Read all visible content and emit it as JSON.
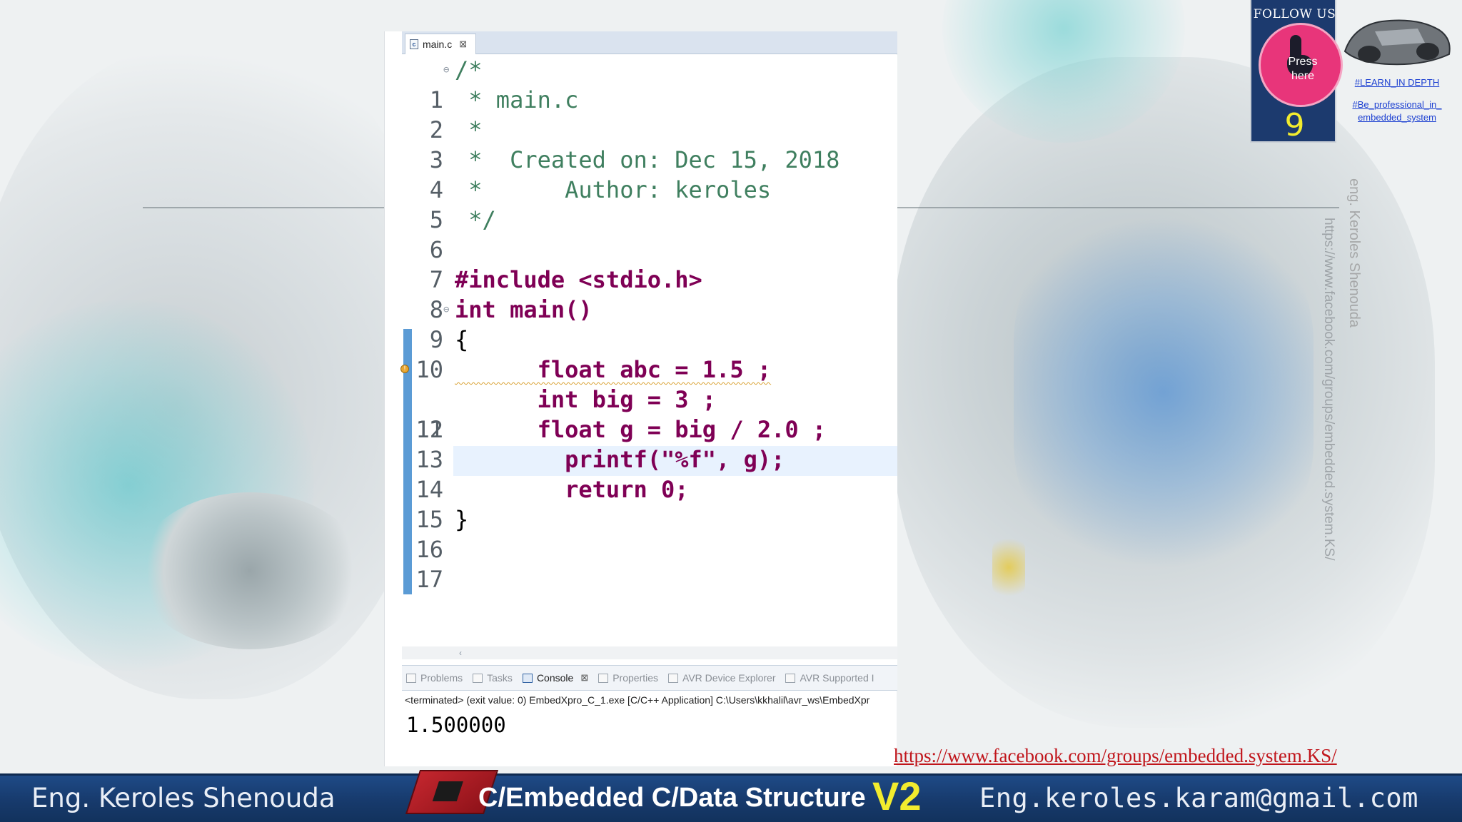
{
  "editor": {
    "tab_label": "main.c",
    "lines": [
      {
        "n": "1",
        "code": "/*"
      },
      {
        "n": "2",
        "code": " * main.c"
      },
      {
        "n": "3",
        "code": " *"
      },
      {
        "n": "4",
        "code": " *  Created on: Dec 15, 2018"
      },
      {
        "n": "5",
        "code": " *      Author: keroles"
      },
      {
        "n": "6",
        "code": " */"
      },
      {
        "n": "7",
        "code": ""
      },
      {
        "n": "8",
        "code": "#include <stdio.h>"
      },
      {
        "n": "9",
        "code": "int main()"
      },
      {
        "n": "10",
        "code": "{"
      },
      {
        "n": "11",
        "code": "      float abc = 1.5 ;"
      },
      {
        "n": "12",
        "code": "      int big = 3 ;"
      },
      {
        "n": "13",
        "code": "      float g = big / 2.0 ;"
      },
      {
        "n": "14",
        "code": "        printf(\"%f\", g);"
      },
      {
        "n": "15",
        "code": "        return 0;"
      },
      {
        "n": "16",
        "code": "}"
      },
      {
        "n": "17",
        "code": ""
      }
    ]
  },
  "console": {
    "tabs": [
      "Problems",
      "Tasks",
      "Console",
      "Properties",
      "AVR Device Explorer",
      "AVR Supported I"
    ],
    "active_tab": "Console",
    "status": "<terminated> (exit value: 0) EmbedXpro_C_1.exe [C/C++ Application] C:\\Users\\kkhalil\\avr_ws\\EmbedXpr",
    "output": "1.500000"
  },
  "follow": {
    "title": "FOLLOW US",
    "press_label_1": "Press",
    "press_label_2": "here",
    "count": "9",
    "tag1": "#LEARN_IN DEPTH",
    "tag2": "#Be_professional_in_",
    "tag3": "embedded_system"
  },
  "side": {
    "name": "eng. Keroles Shenouda",
    "url": "https://www.facebook.com/groups/embedded.system.KS/"
  },
  "footer": {
    "fb_url": "https://www.facebook.com/groups/embedded.system.KS/",
    "name": "Eng. Keroles Shenouda",
    "course": "C/Embedded C/Data Structure",
    "version": "V2",
    "email": "Eng.keroles.karam@gmail.com"
  },
  "colors": {
    "comment": "#3f7f5f",
    "keyword": "#7f0055",
    "string": "#2a00ff",
    "banner": "#173a6c",
    "accent_yellow": "#f2ec2e",
    "link_red": "#c0151b"
  }
}
